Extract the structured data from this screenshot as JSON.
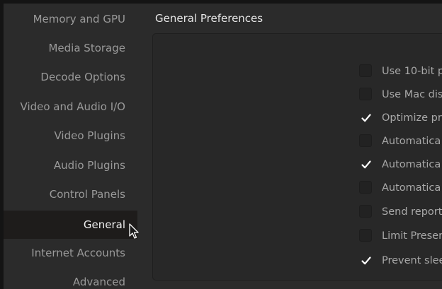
{
  "sidebar": {
    "items": [
      {
        "label": "Memory and GPU"
      },
      {
        "label": "Media Storage"
      },
      {
        "label": "Decode Options"
      },
      {
        "label": "Video and Audio I/O"
      },
      {
        "label": "Video Plugins"
      },
      {
        "label": "Audio Plugins"
      },
      {
        "label": "Control Panels"
      },
      {
        "label": "General",
        "selected": true
      },
      {
        "label": "Internet Accounts"
      },
      {
        "label": "Advanced"
      }
    ]
  },
  "main": {
    "title": "General Preferences",
    "options": [
      {
        "label": "Use 10-bit p",
        "checked": false
      },
      {
        "label": "Use Mac dis",
        "checked": false
      },
      {
        "label": "Optimize pr",
        "checked": true
      },
      {
        "label": "Automatica",
        "checked": false
      },
      {
        "label": "Automatica",
        "checked": true
      },
      {
        "label": "Automatica",
        "checked": false
      },
      {
        "label": "Send report",
        "checked": false
      },
      {
        "label": "Limit Preser",
        "checked": false
      },
      {
        "label": "Prevent slee",
        "checked": true
      }
    ]
  },
  "colors": {
    "background": "#2b2b2b",
    "selected_item_bg": "#1e1c1b",
    "checkmark": "#ffffff"
  }
}
